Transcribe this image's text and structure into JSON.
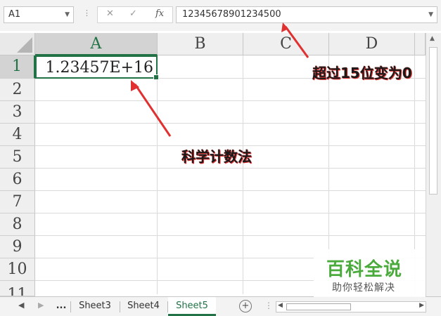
{
  "formula_bar": {
    "name_box": "A1",
    "cancel_glyph": "✕",
    "enter_glyph": "✓",
    "fx_label": "fx",
    "formula_value": "12345678901234500"
  },
  "columns": [
    "A",
    "B",
    "C",
    "D"
  ],
  "rows": [
    "1",
    "2",
    "3",
    "4",
    "5",
    "6",
    "7",
    "8",
    "9",
    "10",
    "11"
  ],
  "cells": {
    "A1": "1.23457E+16"
  },
  "sheet_tabs": {
    "more": "...",
    "tabs": [
      "Sheet3",
      "Sheet4",
      "Sheet5"
    ],
    "active": "Sheet5",
    "add_glyph": "+"
  },
  "annotations": {
    "formula_note": "超过15位变为0",
    "cell_note": "科学计数法"
  },
  "watermark": {
    "title": "百科全说",
    "subtitle": "助你轻松解决"
  },
  "colors": {
    "accent": "#217346",
    "arrow": "#e03030",
    "watermark_green": "#4aaa3c"
  }
}
